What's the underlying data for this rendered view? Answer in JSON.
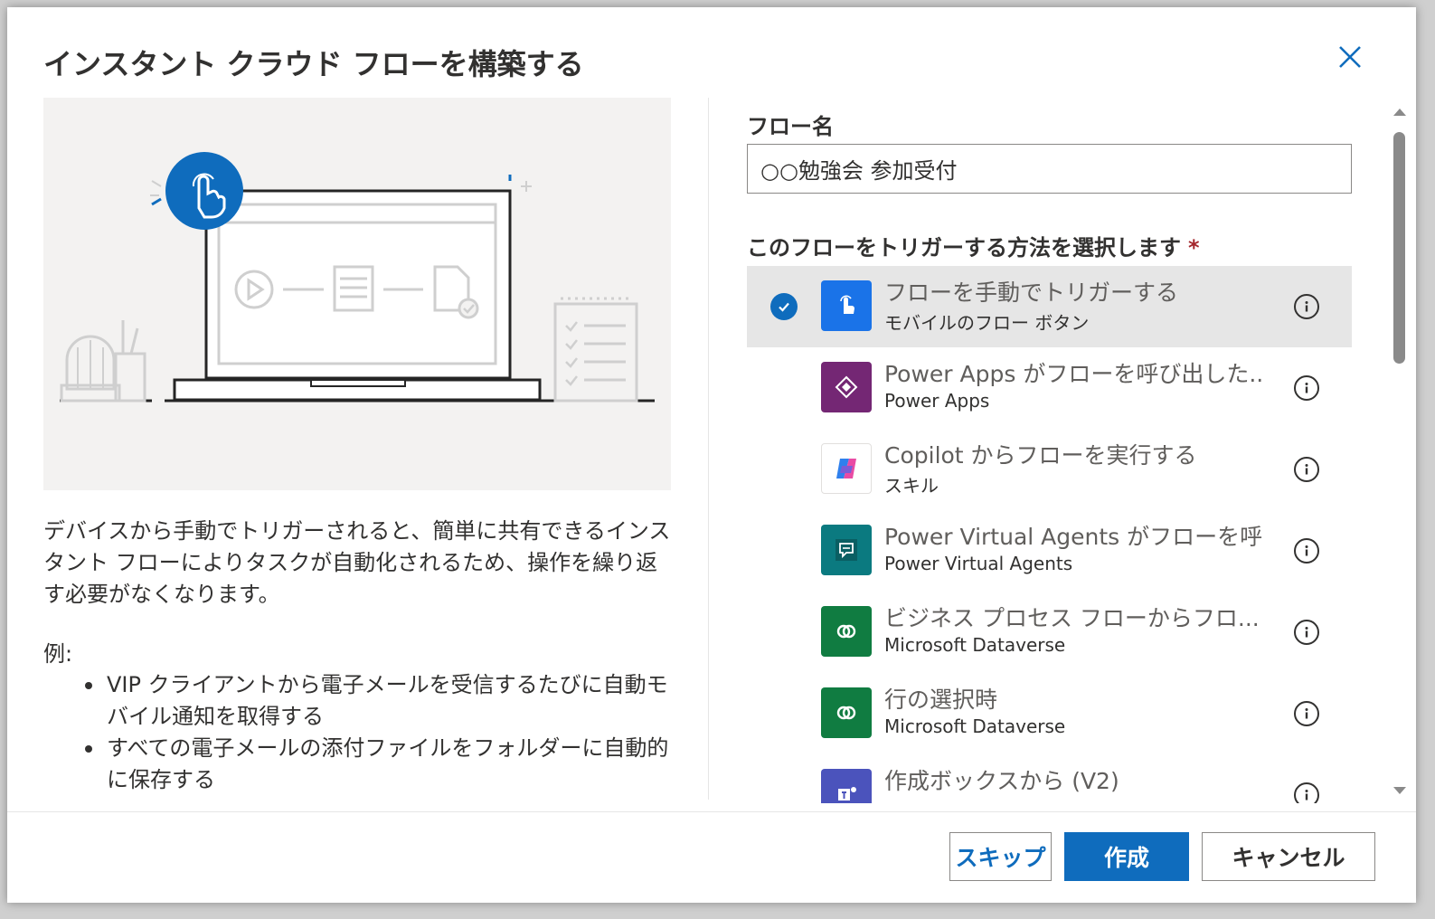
{
  "dialog": {
    "title": "インスタント クラウド フローを構築する",
    "description": "デバイスから手動でトリガーされると、簡単に共有できるインスタント フローによりタスクが自動化されるため、操作を繰り返す必要がなくなります。",
    "example_label": "例:",
    "examples": [
      "VIP クライアントから電子メールを受信するたびに自動モバイル通知を取得する",
      "すべての電子メールの添付ファイルをフォルダーに自動的に保存する"
    ]
  },
  "form": {
    "flow_name_label": "フロー名",
    "flow_name_value": "○○勉強会 参加受付",
    "trigger_label": "このフローをトリガーする方法を選択します",
    "required_mark": "*"
  },
  "triggers": [
    {
      "title": "フローを手動でトリガーする",
      "subtitle": "モバイルのフロー ボタン",
      "icon": "hand-tap-icon",
      "color": "#1a73e8",
      "selected": true
    },
    {
      "title": "Power Apps がフローを呼び出した...",
      "subtitle": "Power Apps",
      "icon": "power-apps-icon",
      "color": "#742774",
      "selected": false
    },
    {
      "title": "Copilot からフローを実行する",
      "subtitle": "スキル",
      "icon": "copilot-icon",
      "color": "#ffffff",
      "selected": false
    },
    {
      "title": "Power Virtual Agents がフローを呼...",
      "subtitle": "Power Virtual Agents",
      "icon": "power-virtual-agents-icon",
      "color": "#0b7a80",
      "selected": false
    },
    {
      "title": "ビジネス プロセス フローからフロ...",
      "subtitle": "Microsoft Dataverse",
      "icon": "dataverse-icon",
      "color": "#107c41",
      "selected": false
    },
    {
      "title": "行の選択時",
      "subtitle": "Microsoft Dataverse",
      "icon": "dataverse-icon",
      "color": "#107c41",
      "selected": false
    },
    {
      "title": "作成ボックスから (V2)",
      "subtitle": "",
      "icon": "teams-icon",
      "color": "#4b53bc",
      "selected": false
    }
  ],
  "buttons": {
    "skip": "スキップ",
    "create": "作成",
    "cancel": "キャンセル"
  },
  "colors": {
    "accent": "#0f6cbd",
    "required": "#a4262c",
    "selected_row": "#e6e6e6"
  }
}
